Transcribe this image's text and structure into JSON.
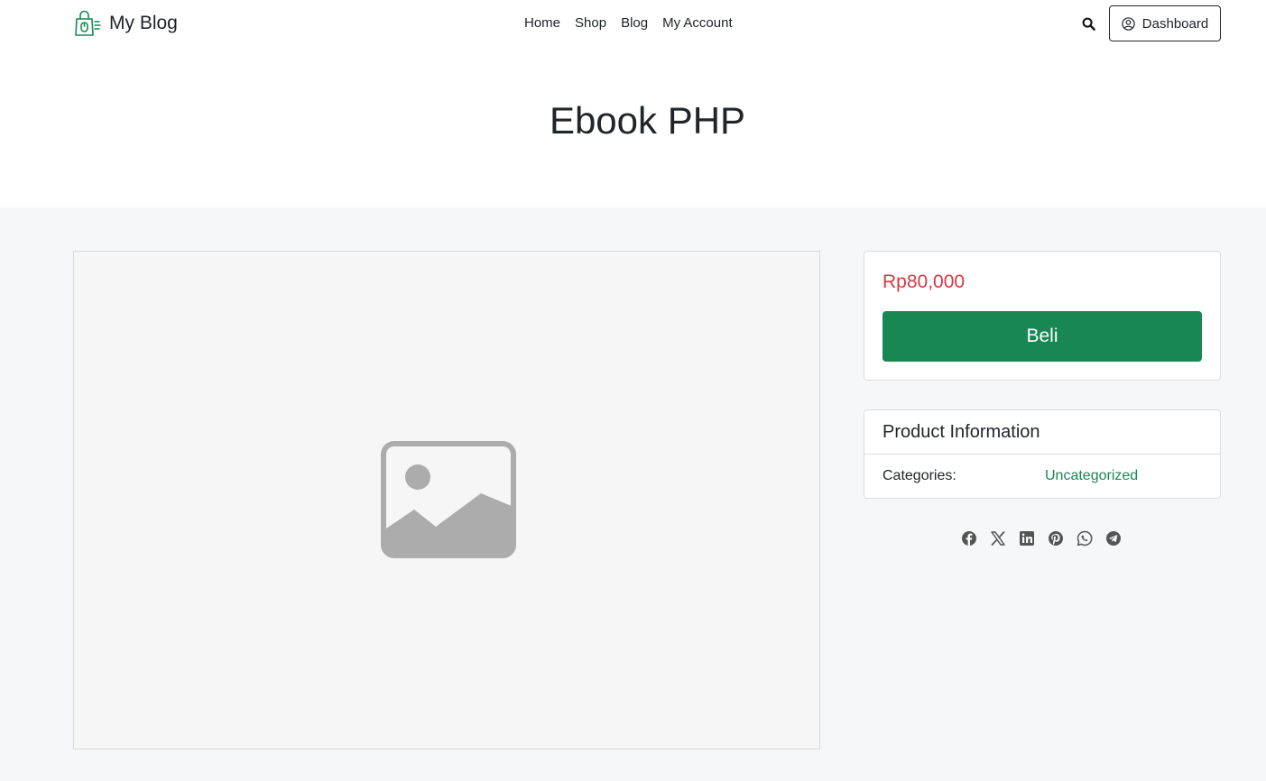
{
  "brand": {
    "name": "My Blog",
    "logo_icon": "shopping-bag-mouse-icon",
    "accent": "#198754"
  },
  "nav": {
    "items": [
      {
        "label": "Home"
      },
      {
        "label": "Shop"
      },
      {
        "label": "Blog"
      },
      {
        "label": "My Account"
      }
    ]
  },
  "header": {
    "search_icon": "search-icon",
    "dashboard_label": "Dashboard",
    "dashboard_icon": "user-circle-icon"
  },
  "page": {
    "title": "Ebook PHP"
  },
  "product": {
    "image_icon": "image-placeholder-icon",
    "price": "Rp80,000",
    "price_color": "#d73a43",
    "buy_label": "Beli",
    "buy_color": "#198754"
  },
  "info": {
    "heading": "Product Information",
    "rows": [
      {
        "label": "Categories:",
        "value": "Uncategorized"
      }
    ]
  },
  "share": {
    "icons": [
      "facebook-icon",
      "x-icon",
      "linkedin-icon",
      "pinterest-icon",
      "whatsapp-icon",
      "telegram-icon"
    ]
  }
}
